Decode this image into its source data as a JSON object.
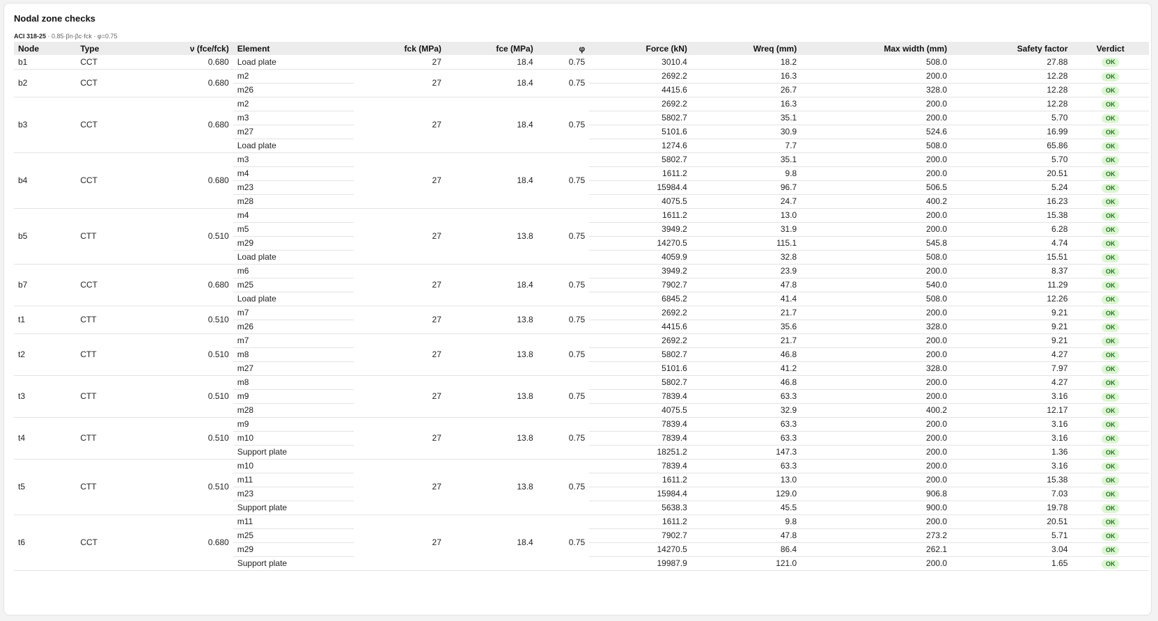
{
  "panel": {
    "title": "Nodal zone checks",
    "code": "ACI 318-25",
    "formula": " · 0.85·βn·βc·fck · φ=0.75"
  },
  "columns": {
    "node": "Node",
    "type": "Type",
    "nu": "ν (fce/fck)",
    "element": "Element",
    "fck": "fck (MPa)",
    "fce": "fce (MPa)",
    "phi": "φ",
    "force": "Force (kN)",
    "wreq": "Wreq (mm)",
    "maxw": "Max width (mm)",
    "sf": "Safety factor",
    "verdict": "Verdict"
  },
  "nodes": [
    {
      "node": "b1",
      "type": "CCT",
      "nu": "0.680",
      "fck": "27",
      "fce": "18.4",
      "phi": "0.75",
      "rows": [
        {
          "element": "Load plate",
          "force": "3010.4",
          "wreq": "18.2",
          "maxw": "508.0",
          "sf": "27.88",
          "verdict": "OK"
        }
      ]
    },
    {
      "node": "b2",
      "type": "CCT",
      "nu": "0.680",
      "fck": "27",
      "fce": "18.4",
      "phi": "0.75",
      "rows": [
        {
          "element": "m2",
          "force": "2692.2",
          "wreq": "16.3",
          "maxw": "200.0",
          "sf": "12.28",
          "verdict": "OK"
        },
        {
          "element": "m26",
          "force": "4415.6",
          "wreq": "26.7",
          "maxw": "328.0",
          "sf": "12.28",
          "verdict": "OK"
        }
      ]
    },
    {
      "node": "b3",
      "type": "CCT",
      "nu": "0.680",
      "fck": "27",
      "fce": "18.4",
      "phi": "0.75",
      "rows": [
        {
          "element": "m2",
          "force": "2692.2",
          "wreq": "16.3",
          "maxw": "200.0",
          "sf": "12.28",
          "verdict": "OK"
        },
        {
          "element": "m3",
          "force": "5802.7",
          "wreq": "35.1",
          "maxw": "200.0",
          "sf": "5.70",
          "verdict": "OK"
        },
        {
          "element": "m27",
          "force": "5101.6",
          "wreq": "30.9",
          "maxw": "524.6",
          "sf": "16.99",
          "verdict": "OK"
        },
        {
          "element": "Load plate",
          "force": "1274.6",
          "wreq": "7.7",
          "maxw": "508.0",
          "sf": "65.86",
          "verdict": "OK"
        }
      ]
    },
    {
      "node": "b4",
      "type": "CCT",
      "nu": "0.680",
      "fck": "27",
      "fce": "18.4",
      "phi": "0.75",
      "rows": [
        {
          "element": "m3",
          "force": "5802.7",
          "wreq": "35.1",
          "maxw": "200.0",
          "sf": "5.70",
          "verdict": "OK"
        },
        {
          "element": "m4",
          "force": "1611.2",
          "wreq": "9.8",
          "maxw": "200.0",
          "sf": "20.51",
          "verdict": "OK"
        },
        {
          "element": "m23",
          "force": "15984.4",
          "wreq": "96.7",
          "maxw": "506.5",
          "sf": "5.24",
          "verdict": "OK"
        },
        {
          "element": "m28",
          "force": "4075.5",
          "wreq": "24.7",
          "maxw": "400.2",
          "sf": "16.23",
          "verdict": "OK"
        }
      ]
    },
    {
      "node": "b5",
      "type": "CTT",
      "nu": "0.510",
      "fck": "27",
      "fce": "13.8",
      "phi": "0.75",
      "rows": [
        {
          "element": "m4",
          "force": "1611.2",
          "wreq": "13.0",
          "maxw": "200.0",
          "sf": "15.38",
          "verdict": "OK"
        },
        {
          "element": "m5",
          "force": "3949.2",
          "wreq": "31.9",
          "maxw": "200.0",
          "sf": "6.28",
          "verdict": "OK"
        },
        {
          "element": "m29",
          "force": "14270.5",
          "wreq": "115.1",
          "maxw": "545.8",
          "sf": "4.74",
          "verdict": "OK"
        },
        {
          "element": "Load plate",
          "force": "4059.9",
          "wreq": "32.8",
          "maxw": "508.0",
          "sf": "15.51",
          "verdict": "OK"
        }
      ]
    },
    {
      "node": "b7",
      "type": "CCT",
      "nu": "0.680",
      "fck": "27",
      "fce": "18.4",
      "phi": "0.75",
      "rows": [
        {
          "element": "m6",
          "force": "3949.2",
          "wreq": "23.9",
          "maxw": "200.0",
          "sf": "8.37",
          "verdict": "OK"
        },
        {
          "element": "m25",
          "force": "7902.7",
          "wreq": "47.8",
          "maxw": "540.0",
          "sf": "11.29",
          "verdict": "OK"
        },
        {
          "element": "Load plate",
          "force": "6845.2",
          "wreq": "41.4",
          "maxw": "508.0",
          "sf": "12.26",
          "verdict": "OK"
        }
      ]
    },
    {
      "node": "t1",
      "type": "CTT",
      "nu": "0.510",
      "fck": "27",
      "fce": "13.8",
      "phi": "0.75",
      "rows": [
        {
          "element": "m7",
          "force": "2692.2",
          "wreq": "21.7",
          "maxw": "200.0",
          "sf": "9.21",
          "verdict": "OK"
        },
        {
          "element": "m26",
          "force": "4415.6",
          "wreq": "35.6",
          "maxw": "328.0",
          "sf": "9.21",
          "verdict": "OK"
        }
      ]
    },
    {
      "node": "t2",
      "type": "CTT",
      "nu": "0.510",
      "fck": "27",
      "fce": "13.8",
      "phi": "0.75",
      "rows": [
        {
          "element": "m7",
          "force": "2692.2",
          "wreq": "21.7",
          "maxw": "200.0",
          "sf": "9.21",
          "verdict": "OK"
        },
        {
          "element": "m8",
          "force": "5802.7",
          "wreq": "46.8",
          "maxw": "200.0",
          "sf": "4.27",
          "verdict": "OK"
        },
        {
          "element": "m27",
          "force": "5101.6",
          "wreq": "41.2",
          "maxw": "328.0",
          "sf": "7.97",
          "verdict": "OK"
        }
      ]
    },
    {
      "node": "t3",
      "type": "CTT",
      "nu": "0.510",
      "fck": "27",
      "fce": "13.8",
      "phi": "0.75",
      "rows": [
        {
          "element": "m8",
          "force": "5802.7",
          "wreq": "46.8",
          "maxw": "200.0",
          "sf": "4.27",
          "verdict": "OK"
        },
        {
          "element": "m9",
          "force": "7839.4",
          "wreq": "63.3",
          "maxw": "200.0",
          "sf": "3.16",
          "verdict": "OK"
        },
        {
          "element": "m28",
          "force": "4075.5",
          "wreq": "32.9",
          "maxw": "400.2",
          "sf": "12.17",
          "verdict": "OK"
        }
      ]
    },
    {
      "node": "t4",
      "type": "CTT",
      "nu": "0.510",
      "fck": "27",
      "fce": "13.8",
      "phi": "0.75",
      "rows": [
        {
          "element": "m9",
          "force": "7839.4",
          "wreq": "63.3",
          "maxw": "200.0",
          "sf": "3.16",
          "verdict": "OK"
        },
        {
          "element": "m10",
          "force": "7839.4",
          "wreq": "63.3",
          "maxw": "200.0",
          "sf": "3.16",
          "verdict": "OK"
        },
        {
          "element": "Support plate",
          "force": "18251.2",
          "wreq": "147.3",
          "maxw": "200.0",
          "sf": "1.36",
          "verdict": "OK"
        }
      ]
    },
    {
      "node": "t5",
      "type": "CTT",
      "nu": "0.510",
      "fck": "27",
      "fce": "13.8",
      "phi": "0.75",
      "rows": [
        {
          "element": "m10",
          "force": "7839.4",
          "wreq": "63.3",
          "maxw": "200.0",
          "sf": "3.16",
          "verdict": "OK"
        },
        {
          "element": "m11",
          "force": "1611.2",
          "wreq": "13.0",
          "maxw": "200.0",
          "sf": "15.38",
          "verdict": "OK"
        },
        {
          "element": "m23",
          "force": "15984.4",
          "wreq": "129.0",
          "maxw": "906.8",
          "sf": "7.03",
          "verdict": "OK"
        },
        {
          "element": "Support plate",
          "force": "5638.3",
          "wreq": "45.5",
          "maxw": "900.0",
          "sf": "19.78",
          "verdict": "OK"
        }
      ]
    },
    {
      "node": "t6",
      "type": "CCT",
      "nu": "0.680",
      "fck": "27",
      "fce": "18.4",
      "phi": "0.75",
      "rows": [
        {
          "element": "m11",
          "force": "1611.2",
          "wreq": "9.8",
          "maxw": "200.0",
          "sf": "20.51",
          "verdict": "OK"
        },
        {
          "element": "m25",
          "force": "7902.7",
          "wreq": "47.8",
          "maxw": "273.2",
          "sf": "5.71",
          "verdict": "OK"
        },
        {
          "element": "m29",
          "force": "14270.5",
          "wreq": "86.4",
          "maxw": "262.1",
          "sf": "3.04",
          "verdict": "OK"
        },
        {
          "element": "Support plate",
          "force": "19987.9",
          "wreq": "121.0",
          "maxw": "200.0",
          "sf": "1.65",
          "verdict": "OK"
        }
      ]
    }
  ],
  "colors": {
    "ok_bg": "#dcf5d2",
    "ok_text": "#1f7a1f",
    "header_bg": "#ececec"
  }
}
